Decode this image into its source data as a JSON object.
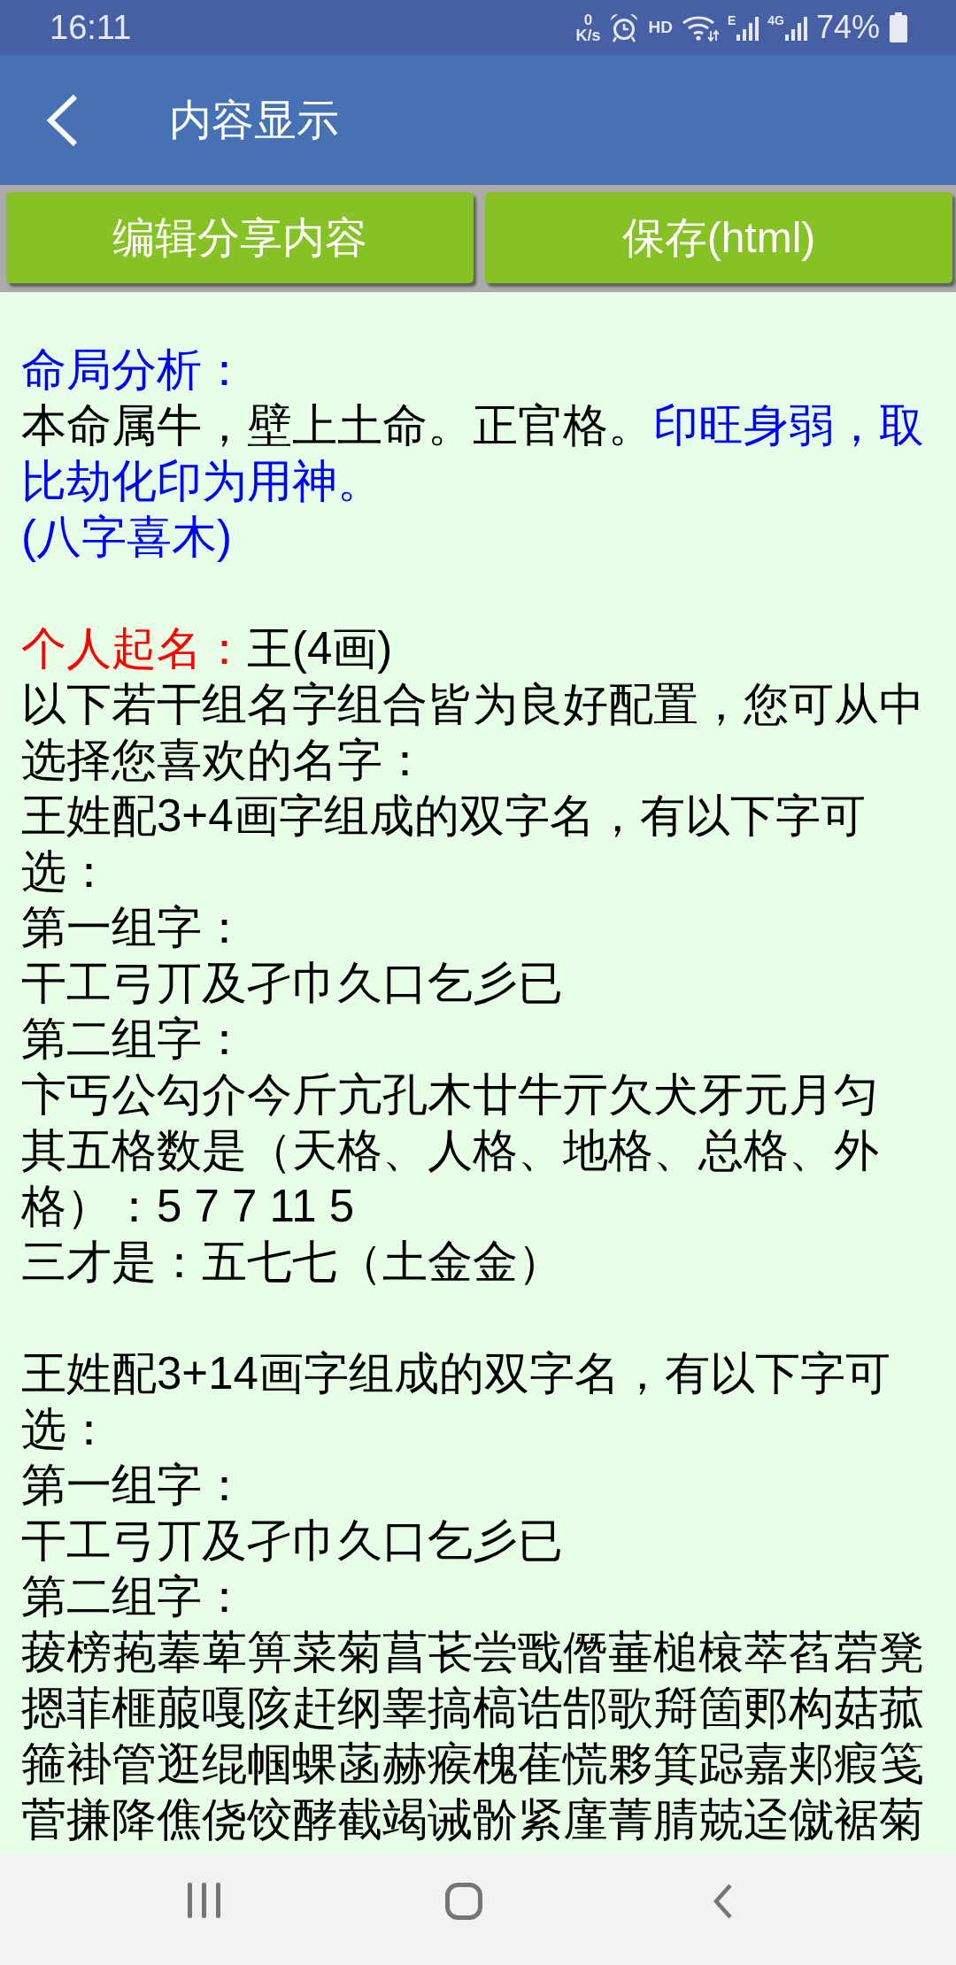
{
  "status_bar": {
    "time": "16:11",
    "net_speed_value": "0",
    "net_speed_unit": "K/s",
    "hd_label": "HD",
    "signals": [
      {
        "label": "E"
      },
      {
        "label": "4G"
      }
    ],
    "battery": "74%"
  },
  "app_bar": {
    "title": "内容显示"
  },
  "buttons": [
    {
      "label": "编辑分享内容"
    },
    {
      "label": "保存(html)"
    }
  ],
  "content": {
    "sections": [
      {
        "paragraphs": [
          {
            "segments": [
              {
                "text": "命局分析：",
                "color": "#0000ff"
              }
            ]
          },
          {
            "segments": [
              {
                "text": "本命属牛，壁上土命。正官格。",
                "color": "#000000"
              },
              {
                "text": "印旺身弱，取比劫化印为用神。",
                "color": "#0000ff"
              }
            ]
          },
          {
            "segments": [
              {
                "text": "(八字喜木)",
                "color": "#0000ff"
              }
            ]
          }
        ]
      },
      {
        "paragraphs": [
          {
            "segments": [
              {
                "text": "个人起名：",
                "color": "#ff0000"
              },
              {
                "text": "王(4画)",
                "color": "#000000"
              }
            ]
          },
          {
            "segments": [
              {
                "text": "以下若干组名字组合皆为良好配置，您可从中选择您喜欢的名字：",
                "color": "#000000"
              }
            ]
          },
          {
            "segments": [
              {
                "text": "王姓配3+4画字组成的双字名，有以下字可选：",
                "color": "#000000"
              }
            ]
          },
          {
            "segments": [
              {
                "text": "第一组字：",
                "color": "#000000"
              }
            ]
          },
          {
            "segments": [
              {
                "text": "干工弓丌及孑巾久口乞彡已",
                "color": "#000000"
              }
            ]
          },
          {
            "segments": [
              {
                "text": "第二组字：",
                "color": "#000000"
              }
            ]
          },
          {
            "segments": [
              {
                "text": "卞丐公勾介今斤亢孔木廿牛亓欠犬牙元月匀",
                "color": "#000000"
              }
            ]
          },
          {
            "segments": [
              {
                "text": "其五格数是（天格、人格、地格、总格、外格）：5 7 7 11 5",
                "color": "#000000"
              }
            ]
          },
          {
            "segments": [
              {
                "text": "三才是：五七七（土金金）",
                "color": "#000000"
              }
            ]
          }
        ]
      },
      {
        "paragraphs": [
          {
            "segments": [
              {
                "text": "王姓配3+14画字组成的双字名，有以下字可选：",
                "color": "#000000"
              }
            ]
          },
          {
            "segments": [
              {
                "text": "第一组字：",
                "color": "#000000"
              }
            ]
          },
          {
            "segments": [
              {
                "text": "干工弓丌及孑巾久口乞彡已",
                "color": "#000000"
              }
            ]
          },
          {
            "segments": [
              {
                "text": "第二组字：",
                "color": "#000000"
              }
            ]
          },
          {
            "segments": [
              {
                "text": "菝榜菢菶萆箅菜菊菖苌尝戬僭菙槌榱萃萏菪凳摁菲榧菔嘎陔赶纲睾搞槁诰郜歌搿箇郠构菇菰箍褂管逛绲帼蜾菡赫瘊槐萑慌夥箕跽嘉郏瘕笺菅搛降僬侥饺酵截竭诫骱紧廑菁腈兢迳僦裾菊",
                "color": "#000000"
              }
            ]
          }
        ]
      }
    ]
  }
}
